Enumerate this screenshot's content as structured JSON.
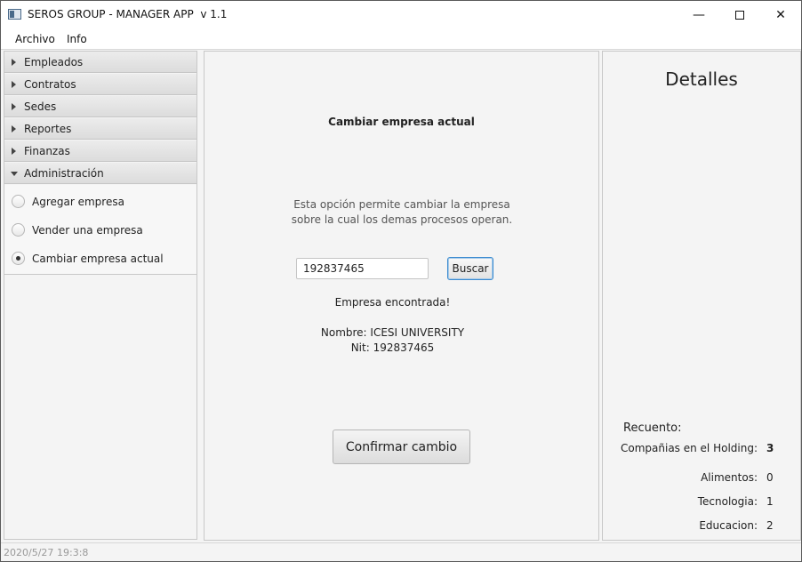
{
  "window": {
    "title": "SEROS GROUP - MANAGER APP  v 1.1",
    "controls": {
      "minimize": "—",
      "close": "✕"
    }
  },
  "menu": [
    "Archivo",
    "Info"
  ],
  "sidebar": {
    "sections": [
      {
        "label": "Empleados",
        "expanded": false
      },
      {
        "label": "Contratos",
        "expanded": false
      },
      {
        "label": "Sedes",
        "expanded": false
      },
      {
        "label": "Reportes",
        "expanded": false
      },
      {
        "label": "Finanzas",
        "expanded": false
      },
      {
        "label": "Administración",
        "expanded": true
      }
    ],
    "admin_options": [
      {
        "label": "Agregar empresa",
        "selected": false
      },
      {
        "label": "Vender una empresa",
        "selected": false
      },
      {
        "label": "Cambiar empresa actual",
        "selected": true
      }
    ]
  },
  "main": {
    "heading": "Cambiar empresa actual",
    "description": "Esta opción permite cambiar la empresa sobre la cual los demas procesos operan.",
    "nit_input_value": "192837465",
    "search_button": "Buscar",
    "found_message": "Empresa encontrada!",
    "company_name": "Nombre: ICESI UNIVERSITY",
    "company_nit": "Nit: 192837465",
    "confirm_button": "Confirmar cambio"
  },
  "details": {
    "title": "Detalles",
    "recuento_label": "Recuento:",
    "stats": [
      {
        "label": "Compañias en el Holding:",
        "value": "3"
      },
      {
        "label": "Alimentos:",
        "value": "0"
      },
      {
        "label": "Tecnologia:",
        "value": "1"
      },
      {
        "label": "Educacion:",
        "value": "2"
      }
    ]
  },
  "status": {
    "date": "2020/5/27",
    "time": "19:3:8"
  }
}
